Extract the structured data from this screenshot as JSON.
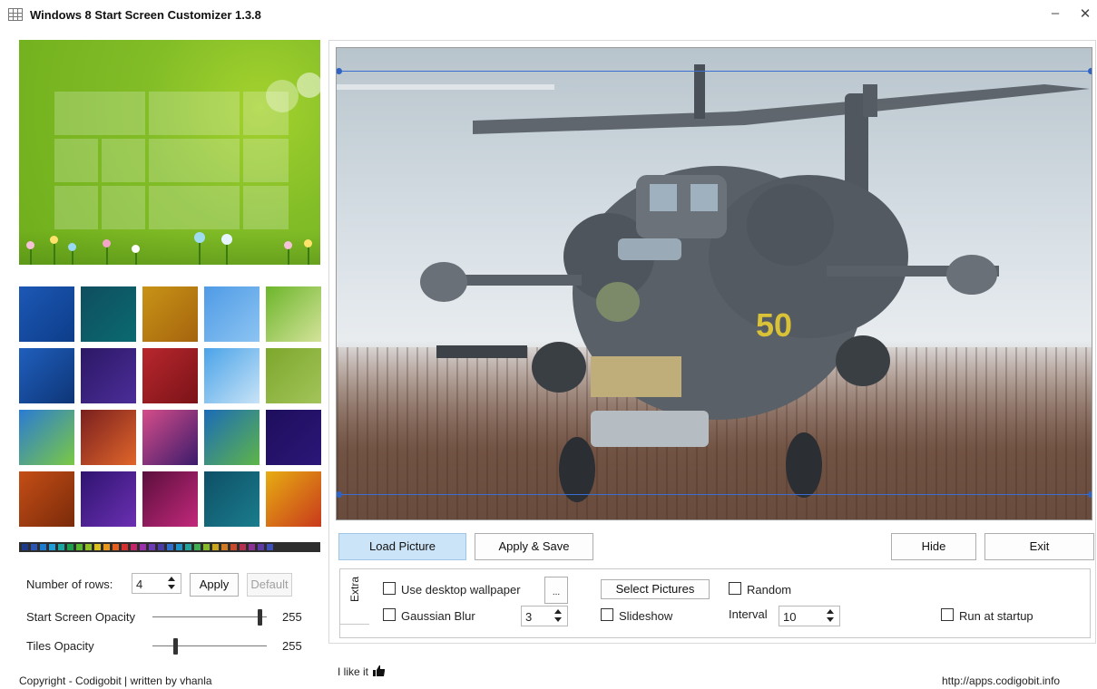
{
  "window": {
    "title": "Windows 8 Start Screen Customizer 1.3.8",
    "minimize_label": "–",
    "close_label": "✕"
  },
  "left_panel": {
    "rows_label": "Number of rows:",
    "rows_value": "4",
    "apply_label": "Apply",
    "default_label": "Default",
    "opacity_label": "Start Screen Opacity",
    "opacity_value": "255",
    "opacity_level": 1.0,
    "tiles_opacity_label": "Tiles Opacity",
    "tiles_opacity_value": "255",
    "tiles_opacity_level": 0.2,
    "palette": [
      "#1b3a8c",
      "#2a55b3",
      "#1a7bd1",
      "#1e9dd8",
      "#16a7a1",
      "#1b9e4b",
      "#55b72c",
      "#8fbf24",
      "#d9c01c",
      "#e8961c",
      "#e5601e",
      "#d62f2f",
      "#c3256b",
      "#9b2fae",
      "#6c3bb5",
      "#4a3ba8",
      "#2f6fd0",
      "#1c94c9",
      "#23a39a",
      "#3fae52",
      "#86b92a",
      "#c9a61d",
      "#d07a23",
      "#c84a2c",
      "#b42f50",
      "#8e3196",
      "#5e3aa8",
      "#3d4fb8"
    ],
    "thumbnails": [
      [
        "#1c58b5",
        "#0d3d8a"
      ],
      [
        "#0f4e5e",
        "#0a6a70"
      ],
      [
        "#c89316",
        "#a5640e"
      ],
      [
        "#4f9be6",
        "#8cc4f2"
      ],
      [
        "#6cb52a",
        "#d4e39a"
      ],
      [
        "#1f5fbd",
        "#0e3577"
      ],
      [
        "#2b1865",
        "#4c2d99"
      ],
      [
        "#b8272d",
        "#7a1318"
      ],
      [
        "#4aa3e8",
        "#c8e3f7"
      ],
      [
        "#7da72c",
        "#a3c45a"
      ],
      [
        "#2a7bd4",
        "#7bc943"
      ],
      [
        "#7a1f1f",
        "#e0662a"
      ],
      [
        "#d64d8a",
        "#3a1b6b"
      ],
      [
        "#1b6bb8",
        "#5fb548"
      ],
      [
        "#1e0e5c",
        "#2b1778"
      ],
      [
        "#c44e16",
        "#7a2a0a"
      ],
      [
        "#2f1470",
        "#6b2fb2"
      ],
      [
        "#5b0f3d",
        "#c2287a"
      ],
      [
        "#0e4f66",
        "#1a7d8c"
      ],
      [
        "#e7ad12",
        "#c8391c"
      ]
    ]
  },
  "toolbar": {
    "load_label": "Load Picture",
    "apply_save_label": "Apply & Save",
    "hide_label": "Hide",
    "exit_label": "Exit"
  },
  "extra": {
    "tab_label": "Extra",
    "use_wallpaper_label": "Use desktop wallpaper",
    "use_wallpaper_checked": false,
    "browse_label": "...",
    "gaussian_label": "Gaussian Blur",
    "gaussian_checked": false,
    "blur_value": "3",
    "select_pictures_label": "Select Pictures",
    "random_label": "Random",
    "random_checked": false,
    "slideshow_label": "Slideshow",
    "slideshow_checked": false,
    "interval_label": "Interval",
    "interval_value": "10",
    "startup_label": "Run at startup",
    "startup_checked": false
  },
  "footer": {
    "copyright": "Copyright - Codigobit | written by vhanla",
    "like": "I like it",
    "url": "http://apps.codigobit.info"
  }
}
